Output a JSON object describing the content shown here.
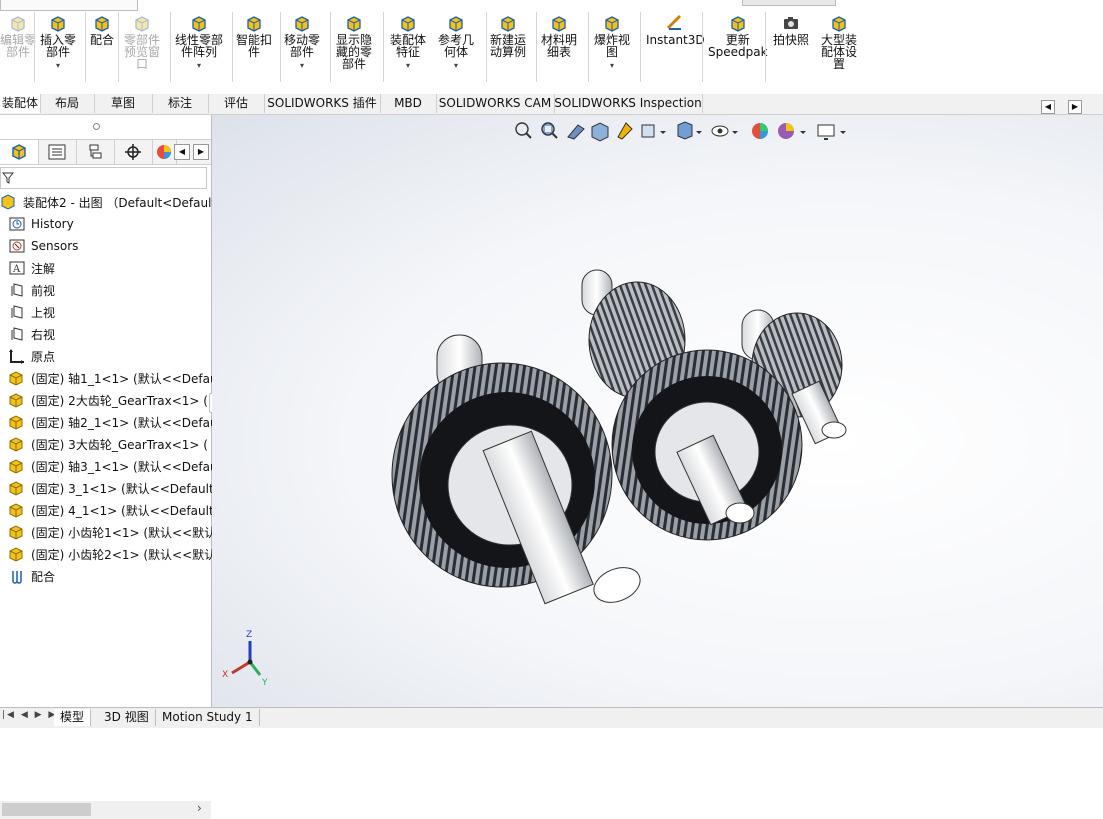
{
  "ribbon": {
    "buttons": [
      {
        "label": "编辑零\n部件",
        "disabled": true,
        "icon": "edit-component-icon"
      },
      {
        "label": "插入零\n部件",
        "dropdown": true,
        "icon": "insert-component-icon"
      },
      {
        "label": "配合",
        "icon": "mate-icon"
      },
      {
        "label": "零部件\n预览窗\n口",
        "disabled": true,
        "icon": "component-preview-icon"
      },
      {
        "label": "线性零部\n件阵列",
        "dropdown": true,
        "icon": "linear-pattern-icon"
      },
      {
        "label": "智能扣\n件",
        "icon": "smart-fastener-icon"
      },
      {
        "label": "移动零\n部件",
        "dropdown": true,
        "icon": "move-component-icon"
      },
      {
        "label": "显示隐\n藏的零\n部件",
        "icon": "show-hidden-icon"
      },
      {
        "label": "装配体\n特征",
        "dropdown": true,
        "icon": "assembly-feature-icon"
      },
      {
        "label": "参考几\n何体",
        "dropdown": true,
        "icon": "reference-geometry-icon"
      },
      {
        "label": "新建运\n动算例",
        "icon": "motion-study-icon"
      },
      {
        "label": "材料明\n细表",
        "icon": "bom-icon"
      },
      {
        "label": "爆炸视\n图",
        "dropdown": true,
        "icon": "exploded-view-icon"
      },
      {
        "label": "Instant3D",
        "icon": "instant3d-icon"
      },
      {
        "label": "更新\nSpeedpak",
        "icon": "speedpak-icon"
      },
      {
        "label": "拍快照",
        "icon": "camera-icon"
      },
      {
        "label": "大型装\n配体设\n置",
        "icon": "large-assembly-icon"
      }
    ]
  },
  "tabs": [
    "装配体",
    "布局",
    "草图",
    "标注",
    "评估",
    "SOLIDWORKS 插件",
    "MBD",
    "SOLIDWORKS CAM",
    "SOLIDWORKS Inspection"
  ],
  "tree": {
    "root": "装配体2 - 出图 （Default<Default_Di",
    "items": [
      {
        "label": "History",
        "icon": "history-icon"
      },
      {
        "label": "Sensors",
        "icon": "sensors-icon"
      },
      {
        "label": "注解",
        "icon": "annotation-icon"
      },
      {
        "label": "前视",
        "icon": "plane-icon"
      },
      {
        "label": "上视",
        "icon": "plane-icon"
      },
      {
        "label": "右视",
        "icon": "plane-icon"
      },
      {
        "label": "原点",
        "icon": "origin-icon"
      },
      {
        "label": "(固定) 轴1_1<1> (默认<<Defau",
        "icon": "part-icon"
      },
      {
        "label": "(固定) 2大齿轮_GearTrax<1> (",
        "icon": "part-icon"
      },
      {
        "label": "(固定) 轴2_1<1> (默认<<Defau",
        "icon": "part-icon"
      },
      {
        "label": "(固定) 3大齿轮_GearTrax<1> (",
        "icon": "part-icon"
      },
      {
        "label": "(固定) 轴3_1<1> (默认<<Defau",
        "icon": "part-icon"
      },
      {
        "label": "(固定) 3_1<1> (默认<<Default>",
        "icon": "part-icon"
      },
      {
        "label": "(固定) 4_1<1> (默认<<Default>",
        "icon": "part-icon"
      },
      {
        "label": "(固定) 小齿轮1<1> (默认<<默认",
        "icon": "part-icon"
      },
      {
        "label": "(固定) 小齿轮2<1> (默认<<默认",
        "icon": "part-icon"
      },
      {
        "label": "配合",
        "icon": "mates-icon"
      }
    ]
  },
  "triad": {
    "x": "X",
    "y": "Y",
    "z": "Z"
  },
  "bottom_tabs": [
    "模型",
    "3D 视图",
    "Motion Study 1"
  ],
  "colors": {
    "accent": "#1f5fa8",
    "tab_bg": "#f1f1f1",
    "gear": "#8c8f96"
  }
}
